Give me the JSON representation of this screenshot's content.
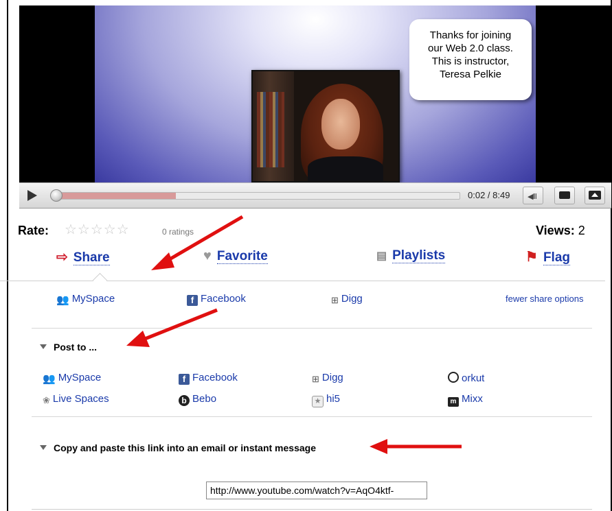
{
  "video": {
    "bubble_lines": [
      "Thanks for joining",
      "our Web 2.0 class.",
      "This is instructor,",
      "Teresa Pelkie"
    ],
    "time": "0:02 / 8:49",
    "progress_fraction": 0.004,
    "buffered_fraction": 0.3
  },
  "rating": {
    "label": "Rate:",
    "stars": "☆☆☆☆☆",
    "count": "0 ratings"
  },
  "views": {
    "label": "Views:",
    "count": "2"
  },
  "actions": {
    "share": "Share",
    "favorite": "Favorite",
    "playlists": "Playlists",
    "flag": "Flag"
  },
  "share_row": {
    "myspace": "MySpace",
    "facebook": "Facebook",
    "digg": "Digg",
    "fewer": "fewer share options"
  },
  "post_to": {
    "title": "Post to ...",
    "items": [
      "MySpace",
      "Facebook",
      "Digg",
      "orkut",
      "Live Spaces",
      "Bebo",
      "hi5",
      "Mixx"
    ]
  },
  "copy_link": {
    "title": "Copy and paste this link into an email or instant message",
    "url": "http://www.youtube.com/watch?v=AqO4ktf-"
  },
  "colors": {
    "link": "#1a3aaa",
    "annotation_arrow": "#e01010"
  }
}
